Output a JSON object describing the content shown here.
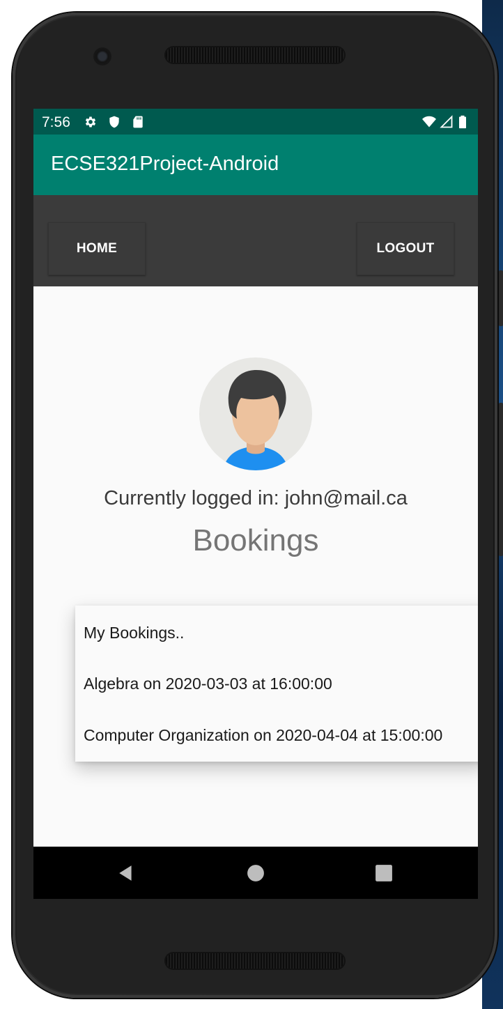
{
  "status_bar": {
    "time": "7:56",
    "left_icons": [
      "gear-icon",
      "shield-icon",
      "sd-card-icon"
    ],
    "right_icons": [
      "wifi-icon",
      "signal-icon",
      "battery-icon"
    ]
  },
  "app_bar": {
    "title": "ECSE321Project-Android"
  },
  "toolbar": {
    "home_label": "HOME",
    "logout_label": "LOGOUT"
  },
  "profile": {
    "avatar_icon": "user-avatar-icon",
    "logged_in_text": "Currently logged in: john@mail.ca"
  },
  "bookings": {
    "heading": "Bookings",
    "items": [
      "My Bookings..",
      "Algebra on 2020-03-03 at 16:00:00",
      "Computer Organization on 2020-04-04 at 15:00:00"
    ]
  },
  "nav_bar": {
    "icons": [
      "back-icon",
      "home-circle-icon",
      "recents-icon"
    ]
  },
  "colors": {
    "status_bar": "#005a4f",
    "app_bar": "#00806f",
    "toolbar": "#3b3b3b",
    "background": "#fafafa",
    "avatar_shirt": "#1e8ff0"
  }
}
